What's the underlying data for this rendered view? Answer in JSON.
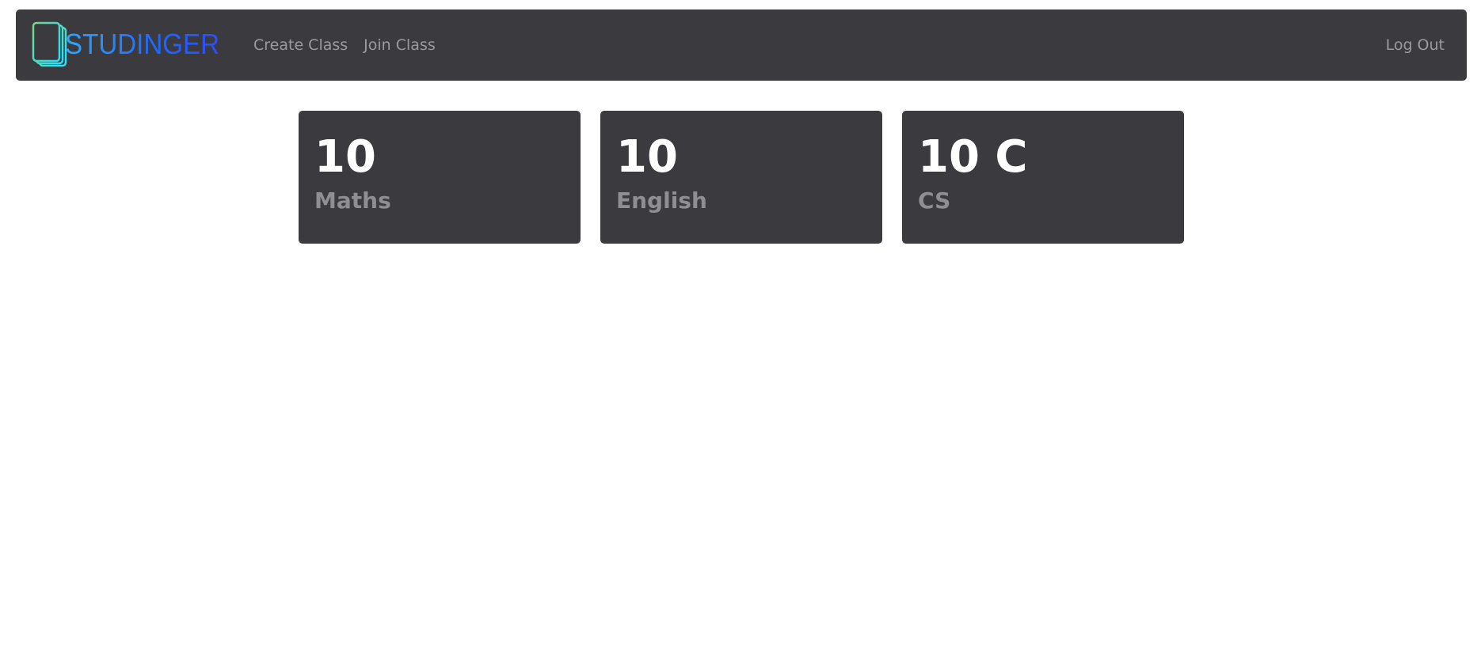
{
  "navbar": {
    "brand_text": "STUDINGER",
    "links": [
      {
        "label": "Create Class"
      },
      {
        "label": "Join Class"
      }
    ],
    "logout_label": "Log Out"
  },
  "classes": [
    {
      "grade": "10",
      "subject": "Maths"
    },
    {
      "grade": "10",
      "subject": "English"
    },
    {
      "grade": "10 C",
      "subject": "CS"
    }
  ],
  "colors": {
    "navbar_bg": "#3b3a3f",
    "card_bg": "#3b3a3f",
    "brand_gradient_start": "#2ea8ff",
    "brand_gradient_end": "#2b4dff",
    "logo_gradient_start": "#7bd389",
    "logo_gradient_end": "#1ee3ff",
    "muted_text": "#9b9a9f"
  }
}
